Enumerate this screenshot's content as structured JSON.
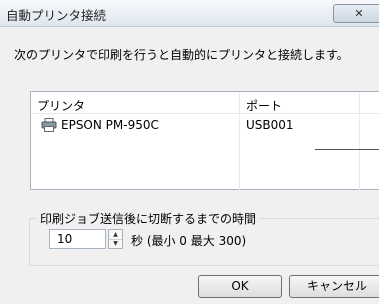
{
  "window": {
    "title": "自動プリンタ接続",
    "close_label": "✕"
  },
  "message": "次のプリンタで印刷を行うと自動的にプリンタと接続します。",
  "printer_list": {
    "columns": [
      "プリンタ",
      "ポート"
    ],
    "rows": [
      {
        "printer": "EPSON PM-950C",
        "port": "USB001",
        "icon": "printer-icon"
      }
    ]
  },
  "timeout": {
    "group_label": "印刷ジョブ送信後に切断するまでの時間",
    "value": "10",
    "unit_text": "秒 (最小 0  最大 300)"
  },
  "buttons": {
    "ok": "OK",
    "cancel": "キャンセル"
  }
}
